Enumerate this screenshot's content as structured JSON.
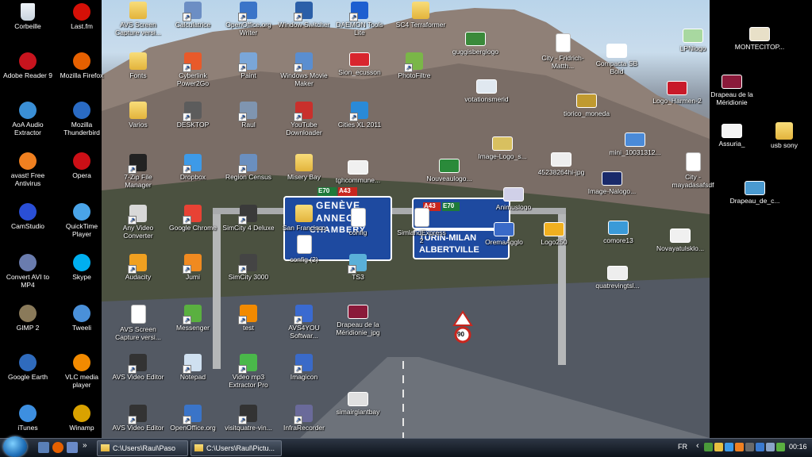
{
  "desktop": {
    "left_icons": [
      {
        "label": "Corbeille",
        "icon": "recycle-bin-icon",
        "color": "#c9d4de",
        "kind": "bin"
      },
      {
        "label": "Last.fm",
        "icon": "lastfm-icon",
        "color": "#d51007"
      },
      {
        "label": "Adobe Reader 9",
        "icon": "adobe-reader-icon",
        "color": "#c8141e"
      },
      {
        "label": "Mozilla Firefox",
        "icon": "firefox-icon",
        "color": "#e66000"
      },
      {
        "label": "AoA Audio Extractor",
        "icon": "aoa-audio-icon",
        "color": "#3a8fd6"
      },
      {
        "label": "Mozilla Thunderbird",
        "icon": "thunderbird-icon",
        "color": "#2a6bc4"
      },
      {
        "label": "avast! Free Antivirus",
        "icon": "avast-icon",
        "color": "#f08020"
      },
      {
        "label": "Opera",
        "icon": "opera-icon",
        "color": "#cc0f16"
      },
      {
        "label": "CamStudio",
        "icon": "camstudio-icon",
        "color": "#2a4fd6"
      },
      {
        "label": "QuickTime Player",
        "icon": "quicktime-icon",
        "color": "#4aa4e8"
      },
      {
        "label": "Convert AVI to MP4",
        "icon": "convert-video-icon",
        "color": "#6a7cae"
      },
      {
        "label": "Skype",
        "icon": "skype-icon",
        "color": "#00aff0"
      },
      {
        "label": "GIMP 2",
        "icon": "gimp-icon",
        "color": "#8a7a5a"
      },
      {
        "label": "Tweeli",
        "icon": "tweeli-icon",
        "color": "#4a90d9"
      },
      {
        "label": "Google Earth",
        "icon": "google-earth-icon",
        "color": "#2f6bbd"
      },
      {
        "label": "VLC media player",
        "icon": "vlc-icon",
        "color": "#f28a00"
      },
      {
        "label": "iTunes",
        "icon": "itunes-icon",
        "color": "#3d8fe0"
      },
      {
        "label": "Winamp",
        "icon": "winamp-icon",
        "color": "#d9a200"
      }
    ],
    "wall_icons": [
      {
        "label": "AVS Screen Capture versi...",
        "icon": "folder-icon",
        "kind": "folder"
      },
      {
        "label": "Calculatrice",
        "icon": "calculator-icon",
        "color": "#6c8ec4",
        "kind": "shortcut"
      },
      {
        "label": "OpenOffice.org Writer",
        "icon": "writer-icon",
        "color": "#3a74c8",
        "kind": "shortcut"
      },
      {
        "label": "Window Switcher",
        "icon": "window-switcher-icon",
        "color": "#2b5fa8",
        "kind": "shortcut"
      },
      {
        "label": "DAEMON Tools Lite",
        "icon": "daemon-tools-icon",
        "color": "#1d5fd0",
        "kind": "shortcut"
      },
      {
        "label": "SC4 Terraformer",
        "icon": "folder-icon",
        "kind": "folder"
      },
      {
        "label": "Fonts",
        "icon": "folder-icon",
        "kind": "folder"
      },
      {
        "label": "Cyberlink Power2Go",
        "icon": "power2go-icon",
        "color": "#e85a2a",
        "kind": "shortcut"
      },
      {
        "label": "Paint",
        "icon": "paint-icon",
        "color": "#7aa6d8",
        "kind": "shortcut"
      },
      {
        "label": "Windows Movie Maker",
        "icon": "movie-maker-icon",
        "color": "#5a8ed0",
        "kind": "shortcut"
      },
      {
        "label": "Sion_ecusson",
        "icon": "image-icon",
        "color": "#d8262e",
        "kind": "thumb"
      },
      {
        "label": "PhotoFiltre",
        "icon": "photofiltre-icon",
        "color": "#7ab648",
        "kind": "shortcut"
      },
      {
        "label": "Varios",
        "icon": "folder-icon",
        "kind": "folder"
      },
      {
        "label": "DESKTOP",
        "icon": "desktop-icon",
        "color": "#5c5c5c",
        "kind": "shortcut"
      },
      {
        "label": "Raul",
        "icon": "user-folder-icon",
        "color": "#7f95b0",
        "kind": "shortcut"
      },
      {
        "label": "YouTube Downloader",
        "icon": "youtube-downloader-icon",
        "color": "#c9302c",
        "kind": "shortcut"
      },
      {
        "label": "Cities XL 2011",
        "icon": "cities-xl-icon",
        "color": "#2a8ad8",
        "kind": "shortcut"
      },
      {
        "label": "7-Zip File Manager",
        "icon": "7zip-icon",
        "color": "#222222",
        "kind": "shortcut"
      },
      {
        "label": "Dropbox",
        "icon": "dropbox-icon",
        "color": "#3d9ae8",
        "kind": "shortcut"
      },
      {
        "label": "Region Census",
        "icon": "region-census-icon",
        "color": "#6a8fbf",
        "kind": "shortcut"
      },
      {
        "label": "Misery Bay",
        "icon": "folder-icon",
        "kind": "folder"
      },
      {
        "label": "tghcommune...",
        "icon": "image-icon",
        "color": "#f0f0f0",
        "kind": "thumb"
      },
      {
        "label": "Any Video Converter",
        "icon": "any-video-icon",
        "color": "#d8d8d8",
        "kind": "shortcut"
      },
      {
        "label": "Google Chrome",
        "icon": "chrome-icon",
        "color": "#e84234",
        "kind": "shortcut"
      },
      {
        "label": "SimCity 4 Deluxe",
        "icon": "simcity4-icon",
        "color": "#3a3a3a",
        "kind": "shortcut"
      },
      {
        "label": "San Francisco",
        "icon": "folder-icon",
        "kind": "folder"
      },
      {
        "label": "config",
        "icon": "config-icon",
        "color": "#4a9a3a",
        "kind": "doc"
      },
      {
        "label": "Audacity",
        "icon": "audacity-icon",
        "color": "#f0a020",
        "kind": "shortcut"
      },
      {
        "label": "Jumi",
        "icon": "jumi-icon",
        "color": "#f08a20",
        "kind": "shortcut"
      },
      {
        "label": "SimCity 3000",
        "icon": "simcity3000-icon",
        "color": "#444444",
        "kind": "shortcut"
      },
      {
        "label": "config (2)",
        "icon": "config-icon",
        "color": "#4a9a3a",
        "kind": "doc"
      },
      {
        "label": "TS3",
        "icon": "ts3-icon",
        "color": "#5ab0d8",
        "kind": "shortcut"
      },
      {
        "label": "AVS Screen Capture versi...",
        "icon": "document-icon",
        "kind": "doc"
      },
      {
        "label": "Messenger",
        "icon": "messenger-icon",
        "color": "#5ab040",
        "kind": "shortcut"
      },
      {
        "label": "test",
        "icon": "vlc-file-icon",
        "color": "#f28a00",
        "kind": "shortcut"
      },
      {
        "label": "AVS4YOU Softwar...",
        "icon": "avs4you-icon",
        "color": "#3a6ad0",
        "kind": "shortcut"
      },
      {
        "label": "Drapeau de la Méridionie_jpg",
        "icon": "flag-icon",
        "color": "#8a1a3a",
        "kind": "thumb"
      },
      {
        "label": "AVS Video Editor",
        "icon": "film-icon",
        "color": "#333333",
        "kind": "shortcut"
      },
      {
        "label": "Notepad",
        "icon": "notepad-icon",
        "color": "#cfe0f0",
        "kind": "shortcut"
      },
      {
        "label": "Video mp3 Extractor Pro",
        "icon": "video-mp3-icon",
        "color": "#4ab84a",
        "kind": "shortcut"
      },
      {
        "label": "Imagicon",
        "icon": "imagicon-icon",
        "color": "#3a6ac8",
        "kind": "shortcut"
      },
      {
        "label": "simairgiantbay",
        "icon": "image-icon",
        "color": "#e0e0e0",
        "kind": "thumb"
      },
      {
        "label": "AVS Video Editor",
        "icon": "film-icon",
        "color": "#333333",
        "kind": "shortcut"
      },
      {
        "label": "OpenOffice.org",
        "icon": "openoffice-icon",
        "color": "#3a74c8",
        "kind": "shortcut"
      },
      {
        "label": "visitquatre-vin...",
        "icon": "film-icon",
        "color": "#333333",
        "kind": "shortcut"
      },
      {
        "label": "InfraRecorder",
        "icon": "infrarecorder-icon",
        "color": "#6a6a9a",
        "kind": "shortcut"
      },
      {
        "label": "guggisberglogo",
        "icon": "image-icon",
        "color": "#3a8a3a",
        "kind": "thumb"
      },
      {
        "label": "City - Fridrich-Matth...",
        "icon": "document-icon",
        "kind": "doc"
      },
      {
        "label": "votationsmerid",
        "icon": "image-icon",
        "color": "#e0e8f0",
        "kind": "thumb"
      },
      {
        "label": "Image-Logo_s...",
        "icon": "image-icon",
        "color": "#d8c060",
        "kind": "thumb"
      },
      {
        "label": "Nouveaulogo...",
        "icon": "image-icon",
        "color": "#2a8a3a",
        "kind": "thumb"
      },
      {
        "label": "45238264hi-jpg",
        "icon": "image-icon",
        "color": "#eeeeee",
        "kind": "thumb"
      },
      {
        "label": "Animuslogo",
        "icon": "image-icon",
        "color": "#d0d0e8",
        "kind": "thumb"
      },
      {
        "label": "SimlandExpress2",
        "icon": "document-icon",
        "kind": "doc"
      },
      {
        "label": "OremaAgglo",
        "icon": "image-icon",
        "color": "#3a6ac8",
        "kind": "thumb"
      },
      {
        "label": "Logo250",
        "icon": "image-icon",
        "color": "#f0b020",
        "kind": "thumb"
      },
      {
        "label": "Compacta SB Bold",
        "icon": "font-file-icon",
        "color": "#ffffff",
        "kind": "thumb"
      },
      {
        "label": "tiorico_moneda",
        "icon": "image-icon",
        "color": "#c09a30",
        "kind": "thumb"
      },
      {
        "label": "mini_10031312...",
        "icon": "image-icon",
        "color": "#4a8ad8",
        "kind": "thumb"
      },
      {
        "label": "Image-Nalogo...",
        "icon": "image-icon",
        "color": "#1a2a6a",
        "kind": "thumb"
      },
      {
        "label": "comore13",
        "icon": "image-icon",
        "color": "#3a9ad8",
        "kind": "thumb"
      },
      {
        "label": "quatrevingtsl...",
        "icon": "image-icon",
        "color": "#eeeeee",
        "kind": "thumb"
      },
      {
        "label": "Logo_Harmen-2",
        "icon": "image-icon",
        "color": "#c81a2a",
        "kind": "thumb"
      },
      {
        "label": "City - mayadasafsdf",
        "icon": "document-icon",
        "kind": "doc"
      },
      {
        "label": "Novayatulsklo...",
        "icon": "image-icon",
        "color": "#f0f0f0",
        "kind": "thumb"
      },
      {
        "label": "LPNlogo",
        "icon": "image-icon",
        "color": "#a8d8a0",
        "kind": "thumb"
      }
    ],
    "right_icons": [
      {
        "label": "MONTECITOP...",
        "icon": "image-icon",
        "color": "#e8e0c8",
        "kind": "thumb"
      },
      {
        "label": "Drapeau de la Méridionie",
        "icon": "flag-icon",
        "color": "#8a1a3a",
        "kind": "thumb"
      },
      {
        "label": "Assuria_",
        "icon": "image-icon",
        "color": "#f4f4f4",
        "kind": "thumb"
      },
      {
        "label": "usb sony",
        "icon": "folder-icon",
        "kind": "folder"
      },
      {
        "label": "Drapeau_de_c...",
        "icon": "image-icon",
        "color": "#4a9ad0",
        "kind": "thumb"
      }
    ],
    "sign": {
      "line1": "GENÈVE",
      "line2": "ANNECY",
      "line3": "CHAMBERY",
      "badge": "A43",
      "badge2": "E70",
      "right1": "TURIN-MILAN",
      "right2": "ALBERTVILLE",
      "right_badge": "A43",
      "right_badge2": "E70",
      "speed": "90"
    }
  },
  "taskbar": {
    "tasks": [
      {
        "label": "C:\\Users\\Raul\\Paso"
      },
      {
        "label": "C:\\Users\\Raul\\Pictu..."
      }
    ],
    "language": "FR",
    "clock": "00:16",
    "colors": {
      "bar": "#1a212b",
      "text": "#ffffff"
    }
  }
}
